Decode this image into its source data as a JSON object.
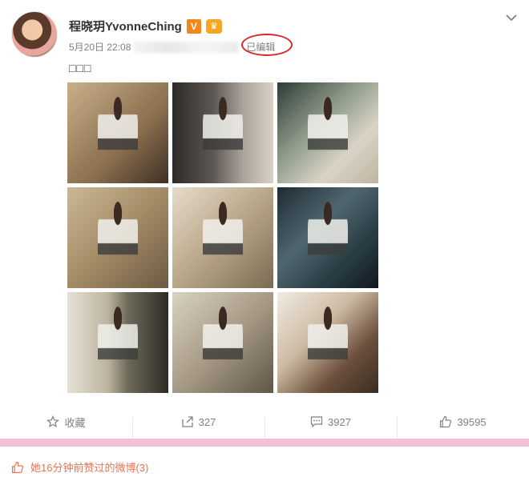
{
  "post": {
    "username": "程晓玥YvonneChing",
    "vip_badge": "V",
    "crown_badge": "♛",
    "date": "5月20日 22:08",
    "edited_label": "已编辑",
    "text": "□□□"
  },
  "actions": {
    "favorite_label": "收藏",
    "repost_count": "327",
    "comment_count": "3927",
    "like_count": "39595"
  },
  "footer": {
    "liked_text": "她16分钟前赞过的微博(3)"
  },
  "colors": {
    "accent_red": "#d9262c",
    "liked_orange": "#eb7350",
    "pink_bar": "#f4c2d4"
  }
}
